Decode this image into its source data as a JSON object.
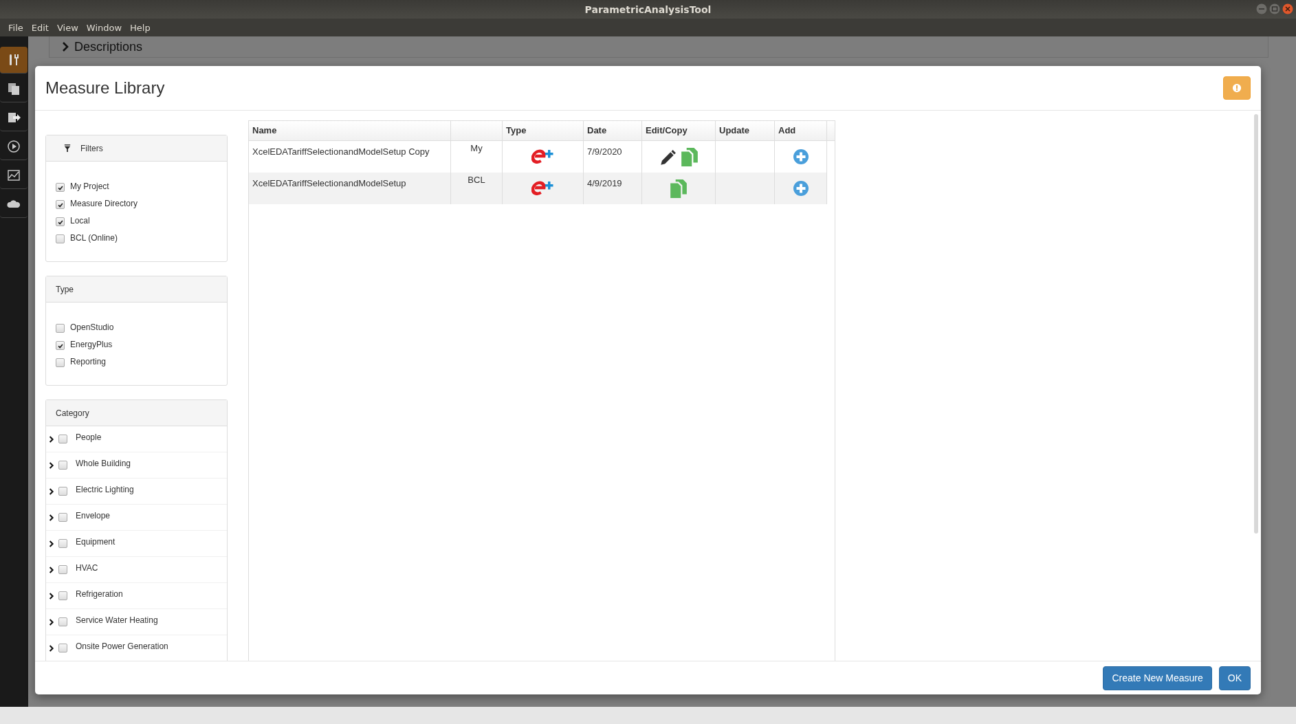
{
  "window": {
    "title": "ParametricAnalysisTool"
  },
  "menu": [
    "File",
    "Edit",
    "View",
    "Window",
    "Help"
  ],
  "sidebar": {
    "items": [
      {
        "selected": true
      },
      {
        "selected": false
      },
      {
        "selected": false
      },
      {
        "selected": false
      },
      {
        "selected": false
      },
      {
        "selected": false
      }
    ]
  },
  "background": {
    "section": "Descriptions"
  },
  "dialog": {
    "title": "Measure Library",
    "filters": {
      "title": "Filters",
      "options": [
        {
          "label": "My Project",
          "checked": true
        },
        {
          "label": "Measure Directory",
          "checked": true
        },
        {
          "label": "Local",
          "checked": true
        },
        {
          "label": "BCL (Online)",
          "checked": false
        }
      ]
    },
    "type_filter": {
      "title": "Type",
      "options": [
        {
          "label": "OpenStudio",
          "checked": false
        },
        {
          "label": "EnergyPlus",
          "checked": true
        },
        {
          "label": "Reporting",
          "checked": false
        }
      ]
    },
    "category": {
      "title": "Category",
      "items": [
        {
          "label": "People",
          "checked": false
        },
        {
          "label": "Whole Building",
          "checked": false
        },
        {
          "label": "Electric Lighting",
          "checked": false
        },
        {
          "label": "Envelope",
          "checked": false
        },
        {
          "label": "Equipment",
          "checked": false
        },
        {
          "label": "HVAC",
          "checked": false
        },
        {
          "label": "Refrigeration",
          "checked": false
        },
        {
          "label": "Service Water Heating",
          "checked": false
        },
        {
          "label": "Onsite Power Generation",
          "checked": false
        }
      ]
    },
    "table": {
      "columns": [
        "Name",
        "Type",
        "Date",
        "Edit/Copy",
        "Update",
        "Add"
      ],
      "rows": [
        {
          "name": "XcelEDATariffSelectionandModelSetup Copy",
          "source": "My",
          "kind": "energyplus",
          "date": "7/9/2020",
          "edit": true,
          "copy": true
        },
        {
          "name": "XcelEDATariffSelectionandModelSetup",
          "source": "BCL",
          "kind": "energyplus",
          "date": "4/9/2019",
          "edit": false,
          "copy": true
        }
      ]
    },
    "buttons": [
      "Create New Measure",
      "OK"
    ]
  }
}
